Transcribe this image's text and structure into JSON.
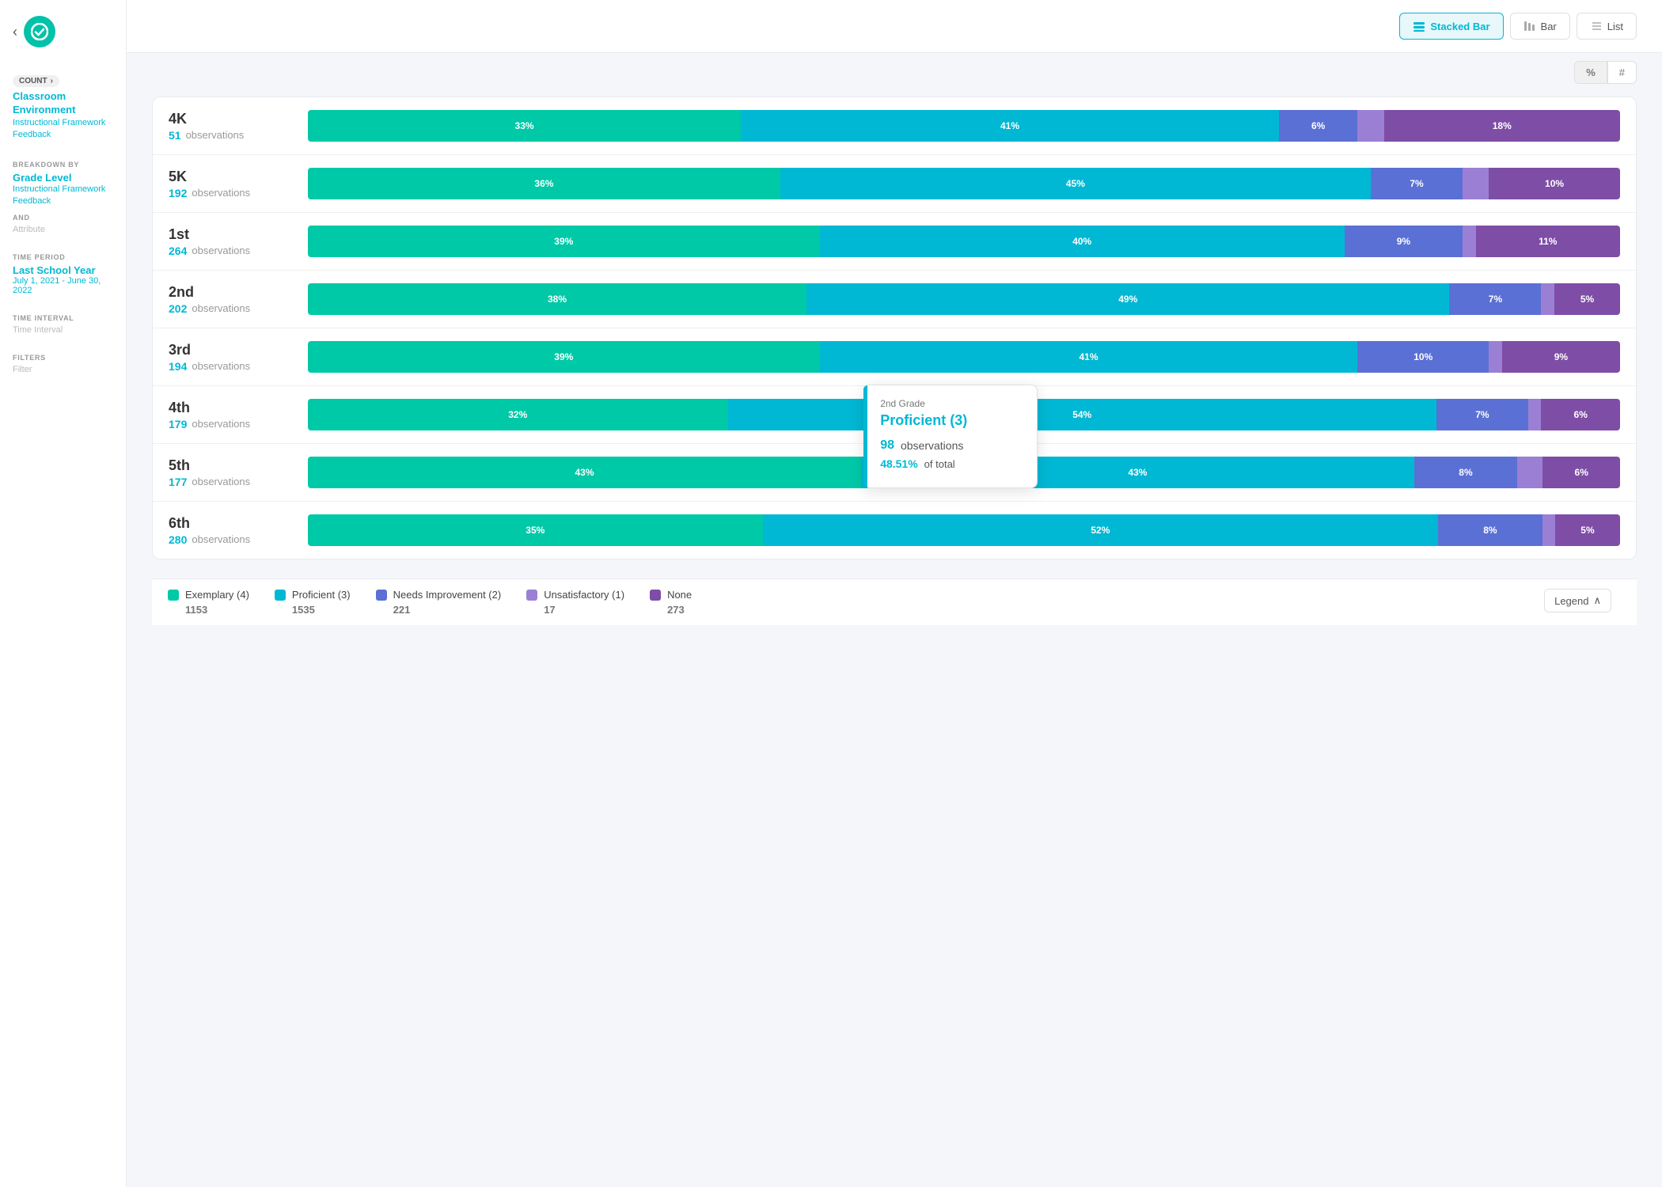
{
  "app": {
    "logo_text": "✓",
    "back_arrow": "‹"
  },
  "sidebar": {
    "count_label": "COUNT",
    "count_chevron": "›",
    "primary_link": "Classroom Environment",
    "secondary_link": "Instructional Framework Feedback",
    "breakdown_label": "BREAKDOWN BY",
    "breakdown_value": "Grade Level",
    "breakdown_link": "Instructional Framework Feedback",
    "and_label": "AND",
    "attribute_label": "Attribute",
    "time_period_label": "TIME PERIOD",
    "time_period_value": "Last School Year",
    "time_period_date": "July 1, 2021 - June 30, 2022",
    "time_interval_label": "TIME INTERVAL",
    "time_interval_value": "Time Interval",
    "filters_label": "FILTERS",
    "filter_value": "Filter"
  },
  "toolbar": {
    "stacked_bar_label": "Stacked Bar",
    "bar_label": "Bar",
    "list_label": "List",
    "percent_label": "%",
    "hash_label": "#"
  },
  "chart": {
    "rows": [
      {
        "grade": "4K",
        "obs_count": "51",
        "obs_text": "observations",
        "segments": [
          {
            "type": "exemplary",
            "pct": 33,
            "label": "33%"
          },
          {
            "type": "proficient",
            "pct": 41,
            "label": "41%"
          },
          {
            "type": "needs-improvement",
            "pct": 6,
            "label": "6%"
          },
          {
            "type": "unsatisfactory",
            "pct": 2,
            "label": ""
          },
          {
            "type": "none",
            "pct": 18,
            "label": "18%"
          }
        ]
      },
      {
        "grade": "5K",
        "obs_count": "192",
        "obs_text": "observations",
        "segments": [
          {
            "type": "exemplary",
            "pct": 36,
            "label": "36%"
          },
          {
            "type": "proficient",
            "pct": 45,
            "label": "45%"
          },
          {
            "type": "needs-improvement",
            "pct": 7,
            "label": "7%"
          },
          {
            "type": "unsatisfactory",
            "pct": 2,
            "label": ""
          },
          {
            "type": "none",
            "pct": 10,
            "label": "10%"
          }
        ]
      },
      {
        "grade": "1st",
        "obs_count": "264",
        "obs_text": "observations",
        "segments": [
          {
            "type": "exemplary",
            "pct": 39,
            "label": "39%"
          },
          {
            "type": "proficient",
            "pct": 40,
            "label": "40%"
          },
          {
            "type": "needs-improvement",
            "pct": 9,
            "label": "9%"
          },
          {
            "type": "unsatisfactory",
            "pct": 1,
            "label": ""
          },
          {
            "type": "none",
            "pct": 11,
            "label": "11%"
          }
        ]
      },
      {
        "grade": "2nd",
        "obs_count": "202",
        "obs_text": "observations",
        "segments": [
          {
            "type": "exemplary",
            "pct": 38,
            "label": "38%"
          },
          {
            "type": "proficient",
            "pct": 49,
            "label": "49%"
          },
          {
            "type": "needs-improvement",
            "pct": 7,
            "label": "7%"
          },
          {
            "type": "unsatisfactory",
            "pct": 1,
            "label": ""
          },
          {
            "type": "none",
            "pct": 5,
            "label": "5%"
          }
        ]
      },
      {
        "grade": "3rd",
        "obs_count": "194",
        "obs_text": "observations",
        "segments": [
          {
            "type": "exemplary",
            "pct": 39,
            "label": "39%"
          },
          {
            "type": "proficient",
            "pct": 41,
            "label": "41%"
          },
          {
            "type": "needs-improvement",
            "pct": 10,
            "label": "10%"
          },
          {
            "type": "unsatisfactory",
            "pct": 1,
            "label": ""
          },
          {
            "type": "none",
            "pct": 9,
            "label": "9%"
          }
        ]
      },
      {
        "grade": "4th",
        "obs_count": "179",
        "obs_text": "observations",
        "segments": [
          {
            "type": "exemplary",
            "pct": 32,
            "label": "32%"
          },
          {
            "type": "proficient",
            "pct": 54,
            "label": "54%"
          },
          {
            "type": "needs-improvement",
            "pct": 7,
            "label": "7%"
          },
          {
            "type": "unsatisfactory",
            "pct": 1,
            "label": ""
          },
          {
            "type": "none",
            "pct": 6,
            "label": "6%"
          }
        ]
      },
      {
        "grade": "5th",
        "obs_count": "177",
        "obs_text": "observations",
        "segments": [
          {
            "type": "exemplary",
            "pct": 43,
            "label": "43%"
          },
          {
            "type": "proficient",
            "pct": 43,
            "label": "43%"
          },
          {
            "type": "needs-improvement",
            "pct": 8,
            "label": "8%"
          },
          {
            "type": "unsatisfactory",
            "pct": 2,
            "label": ""
          },
          {
            "type": "none",
            "pct": 6,
            "label": "6%"
          }
        ]
      },
      {
        "grade": "6th",
        "obs_count": "280",
        "obs_text": "observations",
        "segments": [
          {
            "type": "exemplary",
            "pct": 35,
            "label": "35%"
          },
          {
            "type": "proficient",
            "pct": 52,
            "label": "52%"
          },
          {
            "type": "needs-improvement",
            "pct": 8,
            "label": "8%"
          },
          {
            "type": "unsatisfactory",
            "pct": 1,
            "label": ""
          },
          {
            "type": "none",
            "pct": 5,
            "label": "5%"
          }
        ]
      }
    ]
  },
  "tooltip": {
    "grade": "2nd Grade",
    "title": "Proficient (3)",
    "count": "98",
    "obs_text": "observations",
    "pct": "48.51%",
    "of_total": "of total"
  },
  "legend": {
    "toggle_label": "Legend",
    "items": [
      {
        "label": "Exemplary (4)",
        "count": "1153",
        "color": "#00c9a7"
      },
      {
        "label": "Proficient (3)",
        "count": "1535",
        "color": "#00b8d4"
      },
      {
        "label": "Needs Improvement (2)",
        "count": "221",
        "color": "#5b70d4"
      },
      {
        "label": "Unsatisfactory (1)",
        "count": "17",
        "color": "#9b7fd4"
      },
      {
        "label": "None",
        "count": "273",
        "color": "#7e4da6"
      }
    ]
  }
}
